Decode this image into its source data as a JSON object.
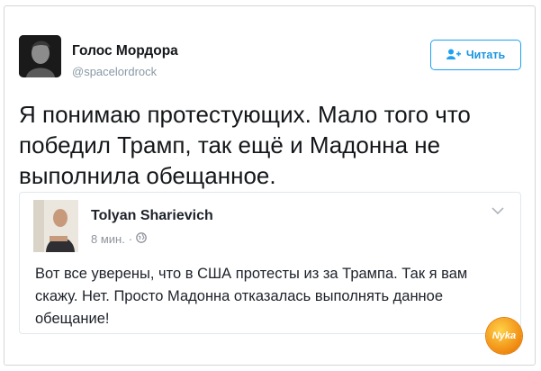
{
  "tweet": {
    "author_name": "Голос Мордора",
    "author_handle": "@spacelordrock",
    "follow_label": "Читать",
    "text": "Я понимаю протестующих. Мало того что победил Трамп, так ещё и Мадонна не выполнила обещанное."
  },
  "quoted_post": {
    "author_name": "Tolyan Sharievich",
    "time": "8 мин.",
    "separator": "·",
    "text": "Вот все уверены, что в США протесты из за Трампа. Так я вам скажу. Нет. Просто Мадонна отказалась выполнять данное обещание!"
  },
  "watermark": {
    "text": "Nyka"
  },
  "icons": {
    "follow": "add-user-icon",
    "privacy": "globe-icon",
    "menu": "chevron-down-icon"
  },
  "colors": {
    "accent": "#1da1f2",
    "text": "#14171a",
    "muted": "#8899a6",
    "border": "#d6d6d6"
  }
}
